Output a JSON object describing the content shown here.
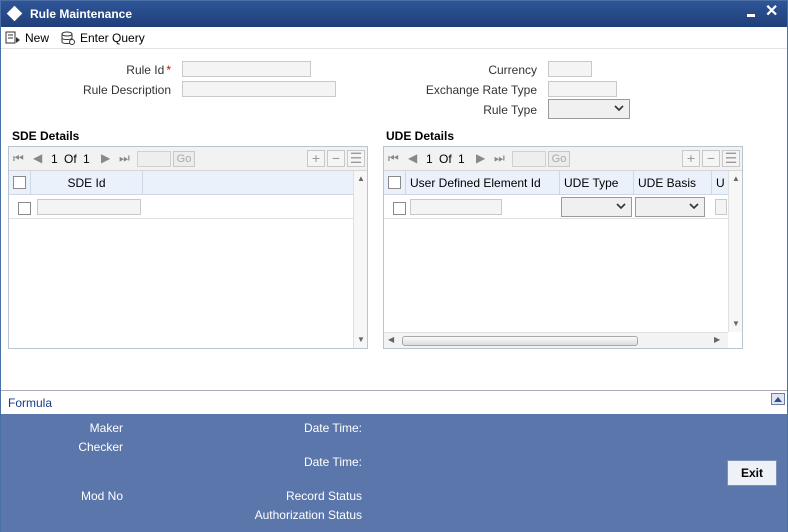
{
  "window": {
    "title": "Rule Maintenance"
  },
  "toolbar": {
    "new_label": "New",
    "enter_query_label": "Enter Query"
  },
  "form": {
    "rule_id_label": "Rule Id",
    "required_mark": "*",
    "rule_description_label": "Rule Description",
    "currency_label": "Currency",
    "exchange_rate_type_label": "Exchange Rate Type",
    "rule_type_label": "Rule Type",
    "rule_id_value": "",
    "rule_description_value": "",
    "currency_value": "",
    "exchange_rate_type_value": "",
    "rule_type_value": ""
  },
  "sde": {
    "title": "SDE Details",
    "pager": {
      "page": "1",
      "of": "Of",
      "total": "1",
      "go": "Go"
    },
    "columns": [
      "SDE Id"
    ]
  },
  "ude": {
    "title": "UDE Details",
    "pager": {
      "page": "1",
      "of": "Of",
      "total": "1",
      "go": "Go"
    },
    "columns": [
      "User Defined Element Id",
      "UDE Type",
      "UDE Basis",
      "U"
    ]
  },
  "formula": {
    "label": "Formula"
  },
  "footer": {
    "maker_label": "Maker",
    "checker_label": "Checker",
    "mod_no_label": "Mod No",
    "date_time_label_1": "Date Time:",
    "date_time_label_2": "Date Time:",
    "record_status_label": "Record Status",
    "authorization_status_label": "Authorization Status",
    "exit_label": "Exit"
  },
  "colors": {
    "title_bar": "#2f5597",
    "footer": "#5a76ab",
    "required": "#cc0000",
    "link": "#1a3a8a"
  }
}
